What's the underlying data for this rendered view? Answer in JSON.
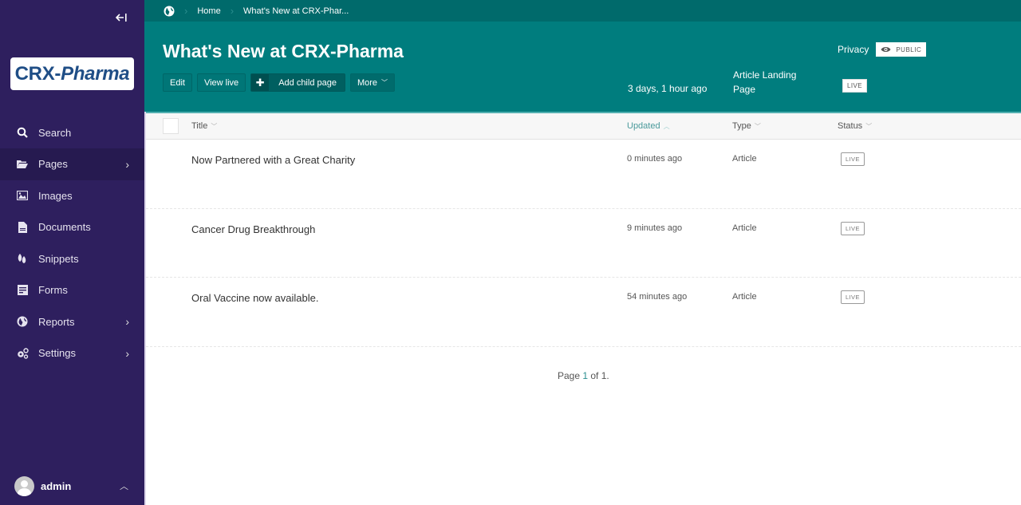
{
  "sidebar": {
    "logo": {
      "part1": "CRX-",
      "part2": "Pharma"
    },
    "collapse_icon": "arrow-left-to-line-icon",
    "search_label": "Search",
    "items": [
      {
        "label": "Pages",
        "icon": "folder-open-icon",
        "has_submenu": true,
        "active": true
      },
      {
        "label": "Images",
        "icon": "image-icon",
        "has_submenu": false
      },
      {
        "label": "Documents",
        "icon": "document-icon",
        "has_submenu": false
      },
      {
        "label": "Snippets",
        "icon": "snippet-icon",
        "has_submenu": false
      },
      {
        "label": "Forms",
        "icon": "form-icon",
        "has_submenu": false
      },
      {
        "label": "Reports",
        "icon": "globe-report-icon",
        "has_submenu": true
      },
      {
        "label": "Settings",
        "icon": "cogs-icon",
        "has_submenu": true
      }
    ],
    "user": {
      "name": "admin"
    }
  },
  "header": {
    "breadcrumb": [
      {
        "label": "Home"
      },
      {
        "label": "What's New at CRX-Phar..."
      }
    ],
    "title": "What's New at CRX-Pharma",
    "buttons": {
      "edit": "Edit",
      "view_live": "View live",
      "add_child": "Add child page",
      "more": "More"
    },
    "updated": "3 days, 1 hour ago",
    "type": "Article Landing Page",
    "status": "LIVE",
    "privacy_label": "Privacy",
    "privacy_value": "PUBLIC"
  },
  "table": {
    "columns": {
      "title": "Title",
      "updated": "Updated",
      "type": "Type",
      "status": "Status"
    },
    "sorted_by": "updated",
    "rows": [
      {
        "title": "Now Partnered with a Great Charity",
        "updated": "0 minutes ago",
        "type": "Article",
        "status": "LIVE"
      },
      {
        "title": "Cancer Drug Breakthrough",
        "updated": "9 minutes ago",
        "type": "Article",
        "status": "LIVE"
      },
      {
        "title": "Oral Vaccine now available.",
        "updated": "54 minutes ago",
        "type": "Article",
        "status": "LIVE"
      }
    ]
  },
  "pagination": {
    "prefix": "Page ",
    "current": "1",
    "middle": " of ",
    "total": "1."
  },
  "colors": {
    "sidebar_bg": "#2e1f5e",
    "header_bg": "#007d7e",
    "breadcrumb_bg": "#006a6b",
    "logo_text": "#1f4e86"
  }
}
